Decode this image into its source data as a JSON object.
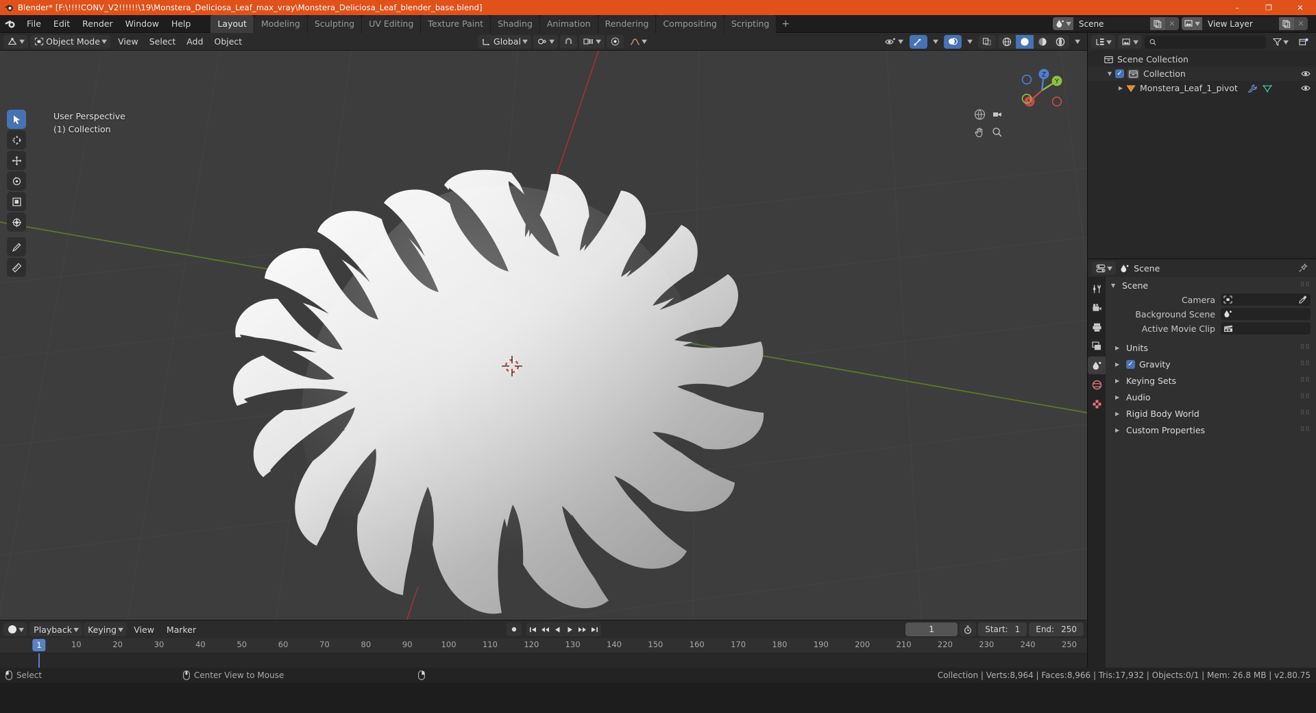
{
  "window": {
    "title": "Blender* [F:\\!!!!CONV_V2!!!!!!\\19\\Monstera_Deliciosa_Leaf_max_vray\\Monstera_Deliciosa_Leaf_blender_base.blend]",
    "minimize": "–",
    "maximize": "❐",
    "close": "✕",
    "titlebar_color": "#e1511a"
  },
  "topbar": {
    "menus": [
      "File",
      "Edit",
      "Render",
      "Window",
      "Help"
    ],
    "workspaces": [
      {
        "label": "Layout",
        "active": true
      },
      {
        "label": "Modeling",
        "active": false
      },
      {
        "label": "Sculpting",
        "active": false
      },
      {
        "label": "UV Editing",
        "active": false
      },
      {
        "label": "Texture Paint",
        "active": false
      },
      {
        "label": "Shading",
        "active": false
      },
      {
        "label": "Animation",
        "active": false
      },
      {
        "label": "Rendering",
        "active": false
      },
      {
        "label": "Compositing",
        "active": false
      },
      {
        "label": "Scripting",
        "active": false
      }
    ],
    "add_workspace": "+",
    "scene_name": "Scene",
    "view_layer_name": "View Layer"
  },
  "viewport_header": {
    "editor_type": "editor-type-3d-viewport",
    "mode": "Object Mode",
    "menus": [
      "View",
      "Select",
      "Add",
      "Object"
    ],
    "transform_orientation": "Global",
    "snap_icon": "magnet-icon",
    "proportional_icon": "proportional-edit-icon"
  },
  "viewport": {
    "perspective_label": "User Perspective",
    "collection_label": "(1) Collection",
    "gizmo_axes": [
      {
        "label": "X",
        "color": "#cc4a4a"
      },
      {
        "label": "Y",
        "color": "#8fbf3f"
      },
      {
        "label": "Z",
        "color": "#4f7fd1"
      }
    ],
    "tools": [
      {
        "name": "tweak-select-tool",
        "active": true
      },
      {
        "name": "cursor-tool",
        "active": false
      },
      {
        "name": "move-tool",
        "active": false
      },
      {
        "name": "rotate-tool",
        "active": false
      },
      {
        "name": "scale-tool",
        "active": false
      },
      {
        "name": "transform-tool",
        "active": false
      },
      {
        "name": "annotate-tool",
        "active": false
      },
      {
        "name": "measure-tool",
        "active": false
      }
    ],
    "shading_modes": [
      "wireframe",
      "solid",
      "material-preview",
      "rendered"
    ],
    "active_shading_mode": "solid"
  },
  "outliner": {
    "search_placeholder": "",
    "display_mode": "View Layer",
    "rows": [
      {
        "indent": 0,
        "label": "Scene Collection",
        "icon": "collection-icon",
        "has_expand": false,
        "has_checkbox": false,
        "eye": false
      },
      {
        "indent": 1,
        "label": "Collection",
        "icon": "collection-icon",
        "has_expand": true,
        "has_checkbox": true,
        "eye": true
      },
      {
        "indent": 2,
        "label": "Monstera_Leaf_1_pivot",
        "icon": "empty-object-icon",
        "has_expand": true,
        "has_checkbox": false,
        "eye": true,
        "extra_icons": [
          "modifier-wrench-icon",
          "mesh-data-icon"
        ]
      }
    ]
  },
  "properties": {
    "breadcrumb": "Scene",
    "panel_title": "Scene",
    "fields": [
      {
        "label": "Camera",
        "value": "",
        "icon": "camera-icon",
        "eyedropper": true
      },
      {
        "label": "Background Scene",
        "value": "",
        "icon": "scene-icon",
        "eyedropper": false
      },
      {
        "label": "Active Movie Clip",
        "value": "",
        "icon": "movieclip-icon",
        "eyedropper": false
      }
    ],
    "sections": [
      {
        "label": "Units",
        "checkbox": false
      },
      {
        "label": "Gravity",
        "checkbox": true,
        "checked": true
      },
      {
        "label": "Keying Sets",
        "checkbox": false
      },
      {
        "label": "Audio",
        "checkbox": false
      },
      {
        "label": "Rigid Body World",
        "checkbox": false
      },
      {
        "label": "Custom Properties",
        "checkbox": false
      }
    ],
    "tabs": [
      {
        "name": "tool-tab",
        "icon": "tool-icon",
        "active": false,
        "color": "#c8c8c8"
      },
      {
        "name": "render-tab",
        "icon": "camera-back-icon",
        "active": false,
        "color": "#c8c8c8"
      },
      {
        "name": "output-tab",
        "icon": "printer-icon",
        "active": false,
        "color": "#c8c8c8"
      },
      {
        "name": "view-layer-tab",
        "icon": "images-icon",
        "active": false,
        "color": "#c8c8c8"
      },
      {
        "name": "scene-tab",
        "icon": "scene-icon",
        "active": true,
        "color": "#d8d8d8"
      },
      {
        "name": "world-tab",
        "icon": "world-icon",
        "active": false,
        "color": "#e07878"
      },
      {
        "name": "texture-tab",
        "icon": "checker-texture-icon",
        "active": false,
        "color": "#e07878"
      }
    ]
  },
  "timeline": {
    "editor_icon": "timeline-icon",
    "menus": [
      "Playback",
      "Keying",
      "View",
      "Marker"
    ],
    "playback_buttons": [
      "record",
      "jump-start",
      "prev-keyframe",
      "play-reverse",
      "play",
      "next-keyframe",
      "jump-end"
    ],
    "current_frame": "1",
    "start_label": "Start:",
    "start_value": "1",
    "end_label": "End:",
    "end_value": "250",
    "auto_key_icon": "stopwatch-icon",
    "ticks": [
      "1",
      "10",
      "20",
      "30",
      "40",
      "50",
      "60",
      "70",
      "80",
      "90",
      "100",
      "110",
      "120",
      "130",
      "140",
      "150",
      "160",
      "170",
      "180",
      "190",
      "200",
      "210",
      "220",
      "230",
      "240",
      "250"
    ],
    "playhead_frame": "1"
  },
  "statusbar": {
    "left_items": [
      {
        "icon": "mouse-left-icon",
        "label": "Select"
      },
      {
        "icon": "mouse-middle-icon",
        "label": "Center View to Mouse"
      },
      {
        "icon": "mouse-right-icon",
        "label": ""
      }
    ],
    "stats": "Collection | Verts:8,964 | Faces:8,966 | Tris:17,932 | Objects:0/1 | Mem: 26.8 MB | v2.80.75"
  }
}
